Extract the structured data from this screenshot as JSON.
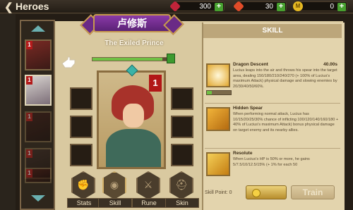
{
  "header": {
    "back_icon": "back-arrow-icon",
    "title": "Heroes",
    "resources": [
      {
        "icon": "ruby-icon",
        "value": "300"
      },
      {
        "icon": "crystal-icon",
        "value": "30"
      },
      {
        "icon": "gold-coin-icon",
        "coin_letter": "M",
        "value": "0"
      }
    ]
  },
  "hero_list": {
    "items": [
      {
        "badge": "1",
        "selected": false
      },
      {
        "badge": "1",
        "selected": true
      },
      {
        "badge": "1",
        "selected": false
      },
      {
        "badge": "1",
        "selected": false
      },
      {
        "badge": "1",
        "selected": false
      }
    ]
  },
  "hero": {
    "name": "卢修斯",
    "title": "The Exiled Prince",
    "level_progress": 0.9,
    "portrait_badge": "1"
  },
  "tabs": [
    {
      "label": "Stats",
      "icon": "fist-icon"
    },
    {
      "label": "Skill",
      "icon": "eye-icon"
    },
    {
      "label": "Rune",
      "icon": "crossed-swords-icon"
    },
    {
      "label": "Skin",
      "icon": "helmet-icon"
    }
  ],
  "skill_panel": {
    "header": "SKILL",
    "skills": [
      {
        "name": "Dragon Descent",
        "time": "40.00s",
        "icon": "burst-icon",
        "description": "Lucius leaps into the air and throws his spear into the target area, dealing 150/180/210/240/270 (+ 100% of Lucius's maximum Attack) physical damage and slowing enemies by 20/30/40/50/60%.",
        "level_progress": 0.2
      },
      {
        "name": "Hidden Spear",
        "time": "",
        "icon": "spear-icon",
        "description": "When performing normal attack, Lucius has 10/15/20/25/30% chance of inflicting 100/120/140/160/180 + 40% of Lucius's maximum Attack) bonus physical damage on target enemy and its nearby allies.",
        "level_progress": 0
      },
      {
        "name": "Resolute",
        "time": "",
        "icon": "shield-icon",
        "description": "When Lucius's HP is 50% or more, he gains 5/7.5/10/12.5/15% (+ 1% for each 50",
        "level_progress": 0
      }
    ],
    "skill_point_label": "Skill Point: 0",
    "train_label": "Train"
  }
}
